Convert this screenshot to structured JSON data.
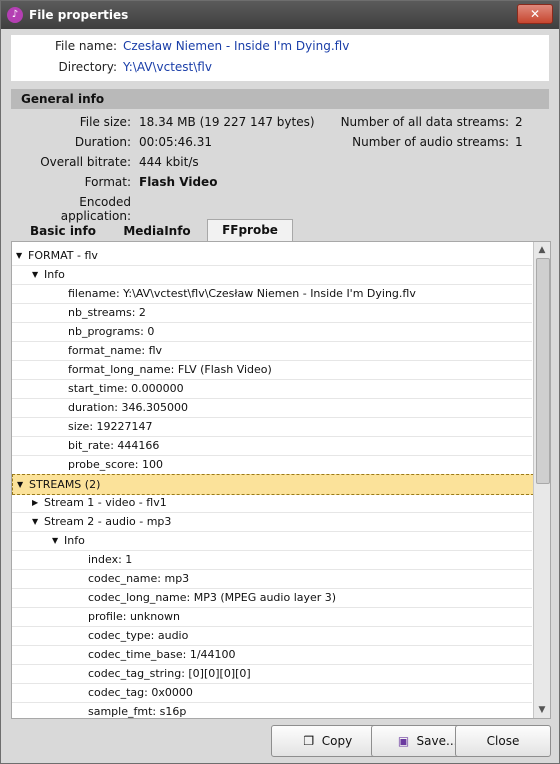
{
  "window": {
    "title": "File properties",
    "close_label": "✕"
  },
  "file_info": {
    "name_label": "File name:",
    "name_value": "Czesław Niemen - Inside I'm Dying.flv",
    "dir_label": "Directory:",
    "dir_value": "Y:\\AV\\vctest\\flv"
  },
  "general": {
    "header": "General info",
    "file_size_label": "File size:",
    "file_size_value": "18.34 MB (19 227 147 bytes)",
    "duration_label": "Duration:",
    "duration_value": "00:05:46.31",
    "bitrate_label": "Overall bitrate:",
    "bitrate_value": "444 kbit/s",
    "format_label": "Format:",
    "format_value": "Flash Video",
    "encoded_label": "Encoded application:",
    "encoded_value": "",
    "streams_label": "Number of all data streams:",
    "streams_value": "2",
    "audio_label": "Number of audio streams:",
    "audio_value": "1"
  },
  "tabs": [
    {
      "label": "Basic info"
    },
    {
      "label": "MediaInfo"
    },
    {
      "label": "FFprobe"
    }
  ],
  "tree_rows": [
    {
      "text": "FORMAT - flv",
      "arrow": "▼"
    },
    {
      "text": "Info",
      "arrow": "▼"
    },
    {
      "text": "filename: Y:\\AV\\vctest\\flv\\Czesław Niemen - Inside I'm Dying.flv",
      "arrow": ""
    },
    {
      "text": "nb_streams: 2",
      "arrow": ""
    },
    {
      "text": "nb_programs: 0",
      "arrow": ""
    },
    {
      "text": "format_name: flv",
      "arrow": ""
    },
    {
      "text": "format_long_name: FLV (Flash Video)",
      "arrow": ""
    },
    {
      "text": "start_time: 0.000000",
      "arrow": ""
    },
    {
      "text": "duration: 346.305000",
      "arrow": ""
    },
    {
      "text": "size: 19227147",
      "arrow": ""
    },
    {
      "text": "bit_rate: 444166",
      "arrow": ""
    },
    {
      "text": "probe_score: 100",
      "arrow": ""
    },
    {
      "text": "STREAMS (2)",
      "arrow": "▼"
    },
    {
      "text": "Stream 1 - video - flv1",
      "arrow": "▶"
    },
    {
      "text": "Stream 2 - audio - mp3",
      "arrow": "▼"
    },
    {
      "text": "Info",
      "arrow": "▼"
    },
    {
      "text": "index: 1",
      "arrow": ""
    },
    {
      "text": "codec_name: mp3",
      "arrow": ""
    },
    {
      "text": "codec_long_name: MP3 (MPEG audio layer 3)",
      "arrow": ""
    },
    {
      "text": "profile: unknown",
      "arrow": ""
    },
    {
      "text": "codec_type: audio",
      "arrow": ""
    },
    {
      "text": "codec_time_base: 1/44100",
      "arrow": ""
    },
    {
      "text": "codec_tag_string: [0][0][0][0]",
      "arrow": ""
    },
    {
      "text": "codec_tag: 0x0000",
      "arrow": ""
    },
    {
      "text": "sample_fmt: s16p",
      "arrow": ""
    }
  ],
  "buttons": {
    "copy_label": "Copy",
    "save_label": "Save...",
    "close_label": "Close"
  },
  "colors": {
    "title_bar": "#4a4a4a",
    "link": "#1a3ea8",
    "selection": "#fbe29a",
    "icon_accent": "#b43fb3"
  }
}
